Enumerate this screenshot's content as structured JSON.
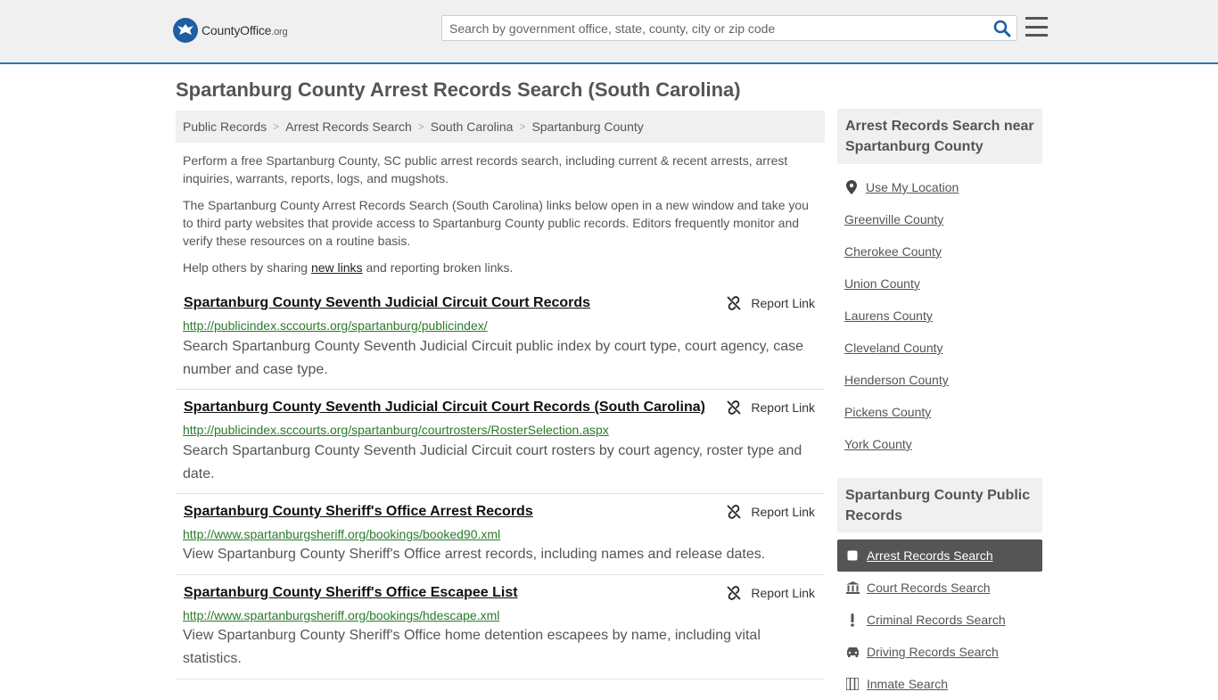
{
  "header": {
    "logo_main": "CountyOffice",
    "logo_org": ".org",
    "search_placeholder": "Search by government office, state, county, city or zip code"
  },
  "page": {
    "title": "Spartanburg County Arrest Records Search (South Carolina)"
  },
  "breadcrumb": [
    "Public Records",
    "Arrest Records Search",
    "South Carolina",
    "Spartanburg County"
  ],
  "intro": {
    "p1": "Perform a free Spartanburg County, SC public arrest records search, including current & recent arrests, arrest inquiries, warrants, reports, logs, and mugshots.",
    "p2": "The Spartanburg County Arrest Records Search (South Carolina) links below open in a new window and take you to third party websites that provide access to Spartanburg County public records. Editors frequently monitor and verify these resources on a routine basis.",
    "p3_before": "Help others by sharing ",
    "p3_link": "new links",
    "p3_after": " and reporting broken links."
  },
  "report_label": "Report Link",
  "listings": [
    {
      "title": "Spartanburg County Seventh Judicial Circuit Court Records",
      "url": "http://publicindex.sccourts.org/spartanburg/publicindex/",
      "desc": "Search Spartanburg County Seventh Judicial Circuit public index by court type, court agency, case number and case type."
    },
    {
      "title": "Spartanburg County Seventh Judicial Circuit Court Records (South Carolina)",
      "url": "http://publicindex.sccourts.org/spartanburg/courtrosters/RosterSelection.aspx",
      "desc": "Search Spartanburg County Seventh Judicial Circuit court rosters by court agency, roster type and date."
    },
    {
      "title": "Spartanburg County Sheriff's Office Arrest Records",
      "url": "http://www.spartanburgsheriff.org/bookings/booked90.xml",
      "desc": "View Spartanburg County Sheriff's Office arrest records, including names and release dates."
    },
    {
      "title": "Spartanburg County Sheriff's Office Escapee List",
      "url": "http://www.spartanburgsheriff.org/bookings/hdescape.xml",
      "desc": "View Spartanburg County Sheriff's Office home detention escapees by name, including vital statistics."
    }
  ],
  "sidebar": {
    "nearby_heading": "Arrest Records Search near Spartanburg County",
    "use_location": "Use My Location",
    "nearby": [
      "Greenville County",
      "Cherokee County",
      "Union County",
      "Laurens County",
      "Cleveland County",
      "Henderson County",
      "Pickens County",
      "York County"
    ],
    "public_heading": "Spartanburg County Public Records",
    "records": [
      {
        "label": "Arrest Records Search",
        "icon": "square-icon",
        "active": true
      },
      {
        "label": "Court Records Search",
        "icon": "courthouse-icon",
        "active": false
      },
      {
        "label": "Criminal Records Search",
        "icon": "exclamation-icon",
        "active": false
      },
      {
        "label": "Driving Records Search",
        "icon": "car-icon",
        "active": false
      },
      {
        "label": "Inmate Search",
        "icon": "inmate-icon",
        "active": false
      }
    ]
  },
  "colors": {
    "accent": "#2d73b4",
    "url_green": "#2a7a2a",
    "active_bg": "#555555"
  }
}
